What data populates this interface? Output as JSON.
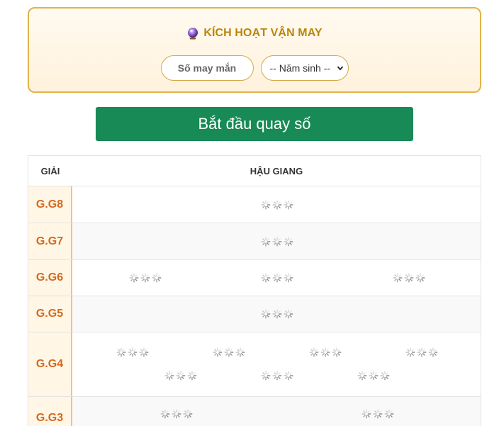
{
  "lucky": {
    "title": "KÍCH HOẠT VẬN MAY",
    "lucky_number_placeholder": "Số may mắn",
    "birth_year_selected": "-- Năm sinh --"
  },
  "start_button": "Bắt đầu quay số",
  "table": {
    "header_prize": "GIẢI",
    "header_province": "HẬU GIANG",
    "rows": [
      {
        "label": "G.G8"
      },
      {
        "label": "G.G7"
      },
      {
        "label": "G.G6"
      },
      {
        "label": "G.G5"
      },
      {
        "label": "G.G4"
      },
      {
        "label": "G.G3"
      }
    ]
  },
  "colors": {
    "accent_gold": "#b8860b",
    "button_green": "#178a55",
    "prize_label": "#d2691e",
    "border_gold": "#e0b44a"
  },
  "icons": {
    "title_icon": "crystal-ball-icon",
    "pending_icon": "loading-spinner-icon"
  }
}
